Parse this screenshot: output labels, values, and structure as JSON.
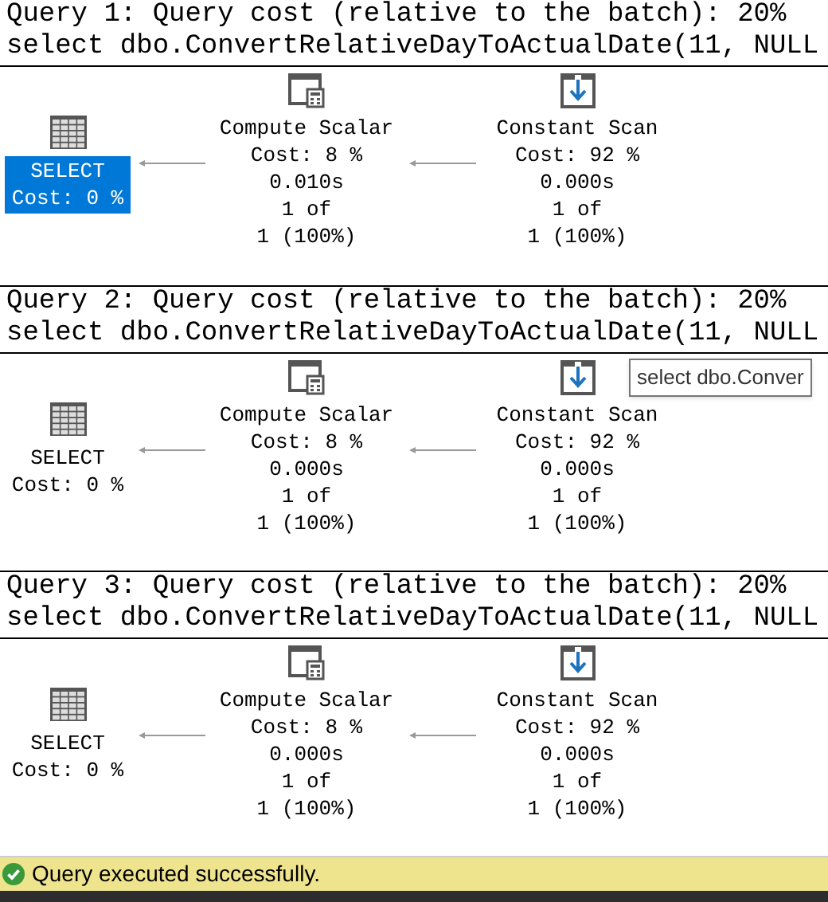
{
  "queries": [
    {
      "header": "Query 1: Query cost (relative to the batch): 20%",
      "sql": "select dbo.ConvertRelativeDayToActualDate(11, NULL",
      "nodes": [
        {
          "kind": "select",
          "label": "SELECT",
          "cost": "Cost: 0 %",
          "selected": true
        },
        {
          "kind": "compute_scalar",
          "label": "Compute Scalar",
          "cost": "Cost: 8 %",
          "time": "0.010s",
          "rows": "1 of",
          "rows_pct": "1 (100%)"
        },
        {
          "kind": "constant_scan",
          "label": "Constant Scan",
          "cost": "Cost: 92 %",
          "time": "0.000s",
          "rows": "1 of",
          "rows_pct": "1 (100%)"
        }
      ]
    },
    {
      "header": "Query 2: Query cost (relative to the batch): 20%",
      "sql": "select dbo.ConvertRelativeDayToActualDate(11, NULL",
      "tooltip": "select dbo.Conver",
      "nodes": [
        {
          "kind": "select",
          "label": "SELECT",
          "cost": "Cost: 0 %",
          "selected": false
        },
        {
          "kind": "compute_scalar",
          "label": "Compute Scalar",
          "cost": "Cost: 8 %",
          "time": "0.000s",
          "rows": "1 of",
          "rows_pct": "1 (100%)"
        },
        {
          "kind": "constant_scan",
          "label": "Constant Scan",
          "cost": "Cost: 92 %",
          "time": "0.000s",
          "rows": "1 of",
          "rows_pct": "1 (100%)"
        }
      ]
    },
    {
      "header": "Query 3: Query cost (relative to the batch): 20%",
      "sql": "select dbo.ConvertRelativeDayToActualDate(11, NULL",
      "nodes": [
        {
          "kind": "select",
          "label": "SELECT",
          "cost": "Cost: 0 %",
          "selected": false
        },
        {
          "kind": "compute_scalar",
          "label": "Compute Scalar",
          "cost": "Cost: 8 %",
          "time": "0.000s",
          "rows": "1 of",
          "rows_pct": "1 (100%)"
        },
        {
          "kind": "constant_scan",
          "label": "Constant Scan",
          "cost": "Cost: 92 %",
          "time": "0.000s",
          "rows": "1 of",
          "rows_pct": "1 (100%)"
        }
      ]
    }
  ],
  "status_bar": {
    "text": "Query executed successfully."
  }
}
